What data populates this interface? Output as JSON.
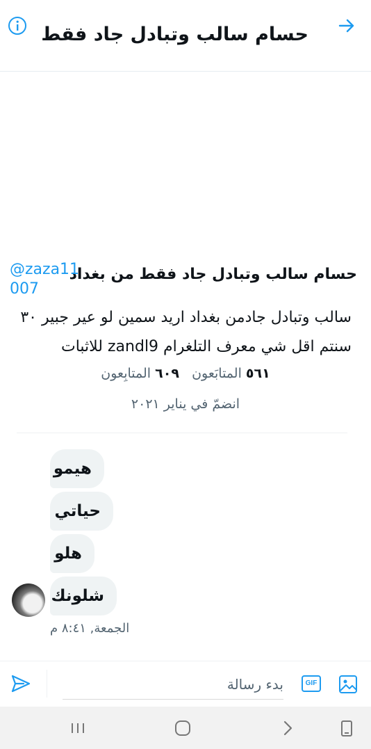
{
  "header": {
    "title": "حسام سالب وتبادل جاد فقط ...",
    "back_icon": "arrow-right-icon",
    "info_icon": "info-icon"
  },
  "profile": {
    "name": "حسام سالب وتبادل جاد فقط من بغداد",
    "handle": "@zaza11007",
    "bio": "سالب وتبادل جادمن بغداد اريد سمين لو عير جبير ٣٠ سنتم اقل شي معرف التلغرام zandl9 للاثبات",
    "following_count": "٥٦١",
    "following_label": "المتابَعون",
    "followers_count": "٦٠٩",
    "followers_label": "المتابِعون",
    "joined": "انضمّ في يناير ٢٠٢١"
  },
  "messages": [
    {
      "text": "هيمو"
    },
    {
      "text": "حياتي"
    },
    {
      "text": "هلو"
    },
    {
      "text": "شلونك"
    }
  ],
  "timestamp": "الجمعة, ٨:٤١ م",
  "composer": {
    "placeholder": "بدء رسالة",
    "gif_label": "GIF",
    "send_icon": "send-icon",
    "image_icon": "image-icon"
  },
  "colors": {
    "accent": "#1d9bf0",
    "bubble": "#eff3f4",
    "muted": "#536471"
  }
}
